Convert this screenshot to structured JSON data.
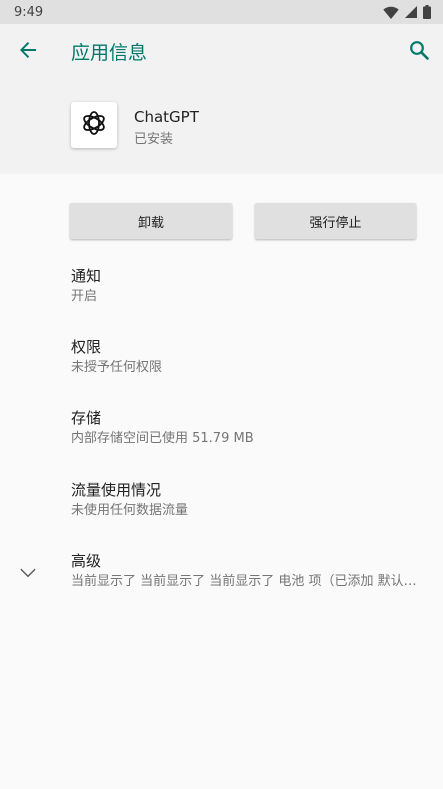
{
  "status_bar": {
    "time": "9:49"
  },
  "app_bar": {
    "title": "应用信息"
  },
  "app": {
    "name": "ChatGPT",
    "status": "已安装"
  },
  "actions": {
    "uninstall": "卸载",
    "force_stop": "强行停止"
  },
  "prefs": [
    {
      "title": "通知",
      "summary": "开启"
    },
    {
      "title": "权限",
      "summary": "未授予任何权限"
    },
    {
      "title": "存储",
      "summary": "内部存储空间已使用 51.79 MB"
    },
    {
      "title": "流量使用情况",
      "summary": "未使用任何数据流量"
    },
    {
      "title": "高级",
      "summary": "当前显示了 当前显示了 当前显示了 电池 项（已添加 默认…"
    }
  ],
  "colors": {
    "accent": "#00796b",
    "status_bar": "#e0e0e0",
    "app_bar": "#f2f2f2",
    "background": "#fafafa"
  }
}
